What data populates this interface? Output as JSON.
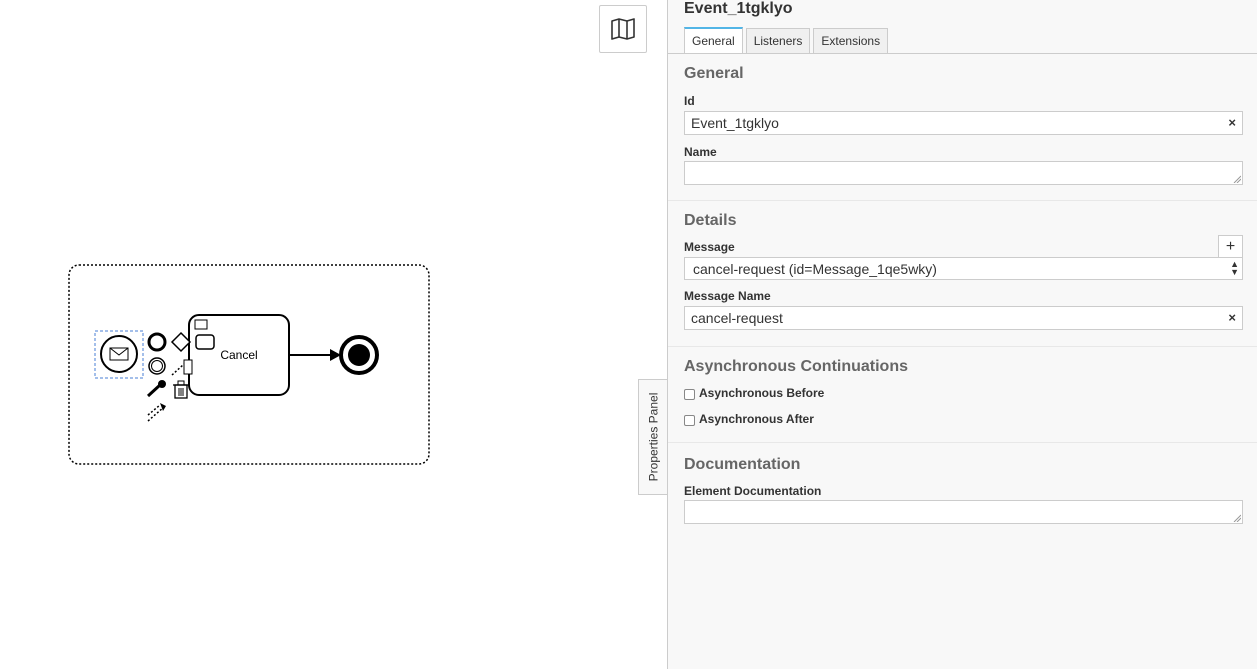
{
  "diagram": {
    "task_label": "Cancel"
  },
  "toolbar": {
    "minimap_icon": "map-icon"
  },
  "panel_toggle_label": "Properties Panel",
  "panel": {
    "title": "Event_1tgklyo",
    "tabs": [
      {
        "label": "General",
        "active": true
      },
      {
        "label": "Listeners",
        "active": false
      },
      {
        "label": "Extensions",
        "active": false
      }
    ],
    "general": {
      "title": "General",
      "id_label": "Id",
      "id_value": "Event_1tgklyo",
      "name_label": "Name",
      "name_value": ""
    },
    "details": {
      "title": "Details",
      "message_label": "Message",
      "message_value": "cancel-request (id=Message_1qe5wky)",
      "message_name_label": "Message Name",
      "message_name_value": "cancel-request",
      "add_symbol": "+"
    },
    "async": {
      "title": "Asynchronous Continuations",
      "before_label": "Asynchronous Before",
      "after_label": "Asynchronous After"
    },
    "documentation": {
      "title": "Documentation",
      "element_doc_label": "Element Documentation"
    },
    "clear_symbol": "×"
  },
  "colors": {
    "accent": "#52b5e6",
    "selection": "#4a7fd4",
    "panel_bg": "#f8f8f8"
  }
}
